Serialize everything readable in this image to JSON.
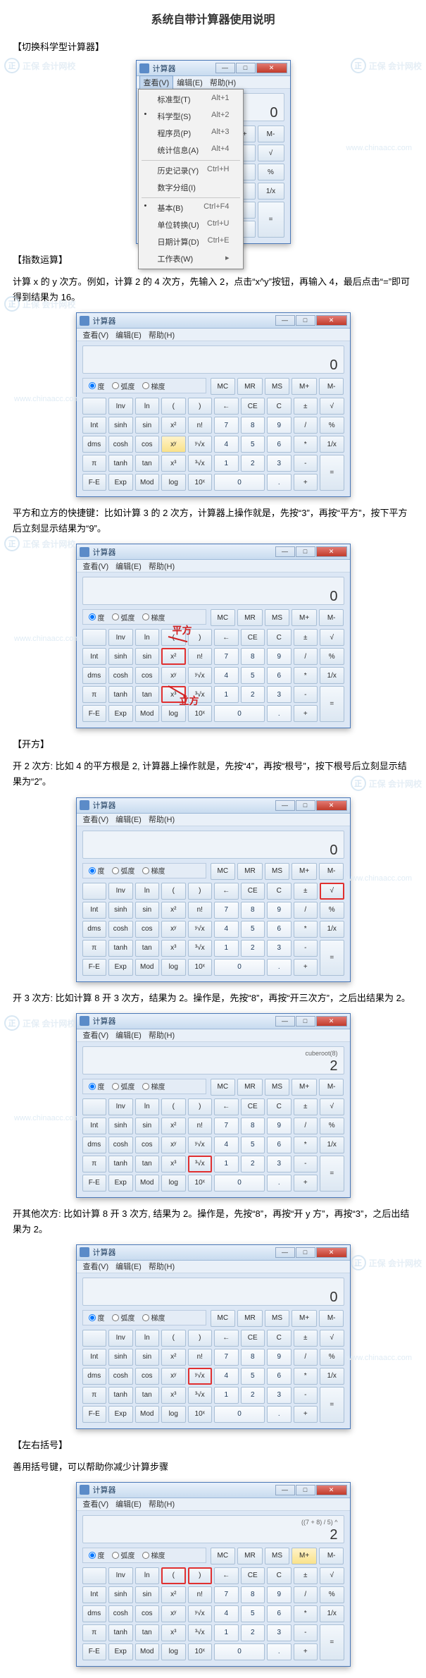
{
  "doc_title": "系统自带计算器使用说明",
  "watermark_brand": "正保 会计网校",
  "watermark_url": "www.chinaacc.com",
  "sections": {
    "s1_heading": "【切换科学型计算器】",
    "s2_heading": "【指数运算】",
    "s2_text": "计算 x 的 y 次方。例如，计算 2 的 4 次方，先输入 2，点击“x^y”按钮，再输入 4，最后点击“=”即可得到结果为 16。",
    "s2b_text": "平方和立方的快捷键：比如计算 3 的 2 次方，计算器上操作就是，先按“3”，再按“平方”，按下平方后立刻显示结果为“9”。",
    "s3_heading": "【开方】",
    "s3_text": "开 2 次方: 比如 4 的平方根是 2, 计算器上操作就是，先按“4”，再按“根号”，按下根号后立刻显示结果为“2”。",
    "s3b_text": "开 3 次方: 比如计算 8 开 3 次方，结果为 2。操作是，先按“8”，再按“开三次方”，之后出结果为 2。",
    "s3c_text": "开其他次方: 比如计算 8 开 3 次方, 结果为 2。操作是，先按“8”，再按“开 y 方”，再按“3”，之后出结果为 2。",
    "s4_heading": "【左右括号】",
    "s4_text": "善用括号键，可以帮助你减少计算步骤"
  },
  "calc": {
    "title": "计算器",
    "minimize": "—",
    "maximize": "□",
    "close": "✕",
    "menu_view": "查看(V)",
    "menu_edit": "编辑(E)",
    "menu_help": "帮助(H)",
    "angle_deg": "度",
    "angle_rad": "弧度",
    "angle_grad": "梯度"
  },
  "dropdown_items": [
    {
      "label": "标准型(T)",
      "shortcut": "Alt+1"
    },
    {
      "label": "科学型(S)",
      "shortcut": "Alt+2",
      "dot": true
    },
    {
      "label": "程序员(P)",
      "shortcut": "Alt+3"
    },
    {
      "label": "统计信息(A)",
      "shortcut": "Alt+4"
    },
    {
      "sep": true
    },
    {
      "label": "历史记录(Y)",
      "shortcut": "Ctrl+H"
    },
    {
      "label": "数字分组(I)",
      "shortcut": ""
    },
    {
      "sep": true
    },
    {
      "label": "基本(B)",
      "shortcut": "Ctrl+F4",
      "dot": true
    },
    {
      "label": "单位转换(U)",
      "shortcut": "Ctrl+U"
    },
    {
      "label": "日期计算(D)",
      "shortcut": "Ctrl+E"
    },
    {
      "label": "工作表(W)",
      "shortcut": "▸"
    }
  ],
  "displays": {
    "d_zero": "0",
    "d_cuberoot_small": "cuberoot(8)",
    "d_cuberoot_main": "2",
    "d_paren_small": "((7 + 8) / 5) ^",
    "d_paren_main": "2"
  },
  "mem_row": [
    "MC",
    "MR",
    "MS",
    "M+",
    "M-"
  ],
  "sci_rows": [
    [
      "",
      "Inv",
      "ln",
      "(",
      ")",
      "←",
      "CE",
      "C",
      "±",
      "√"
    ],
    [
      "Int",
      "sinh",
      "sin",
      "x²",
      "n!",
      "7",
      "8",
      "9",
      "/",
      "%"
    ],
    [
      "dms",
      "cosh",
      "cos",
      "xʸ",
      "ʸ√x",
      "4",
      "5",
      "6",
      "*",
      "1/x"
    ],
    [
      "π",
      "tanh",
      "tan",
      "x³",
      "³√x",
      "1",
      "2",
      "3",
      "-",
      "="
    ],
    [
      "F-E",
      "Exp",
      "Mod",
      "log",
      "10ˣ",
      "0",
      "",
      ".",
      "+",
      ""
    ]
  ],
  "std_rows": [
    [
      "←",
      "CE",
      "C",
      "±",
      "√"
    ],
    [
      "7",
      "8",
      "9",
      "/",
      "%"
    ],
    [
      "4",
      "5",
      "6",
      "*",
      "1/x"
    ],
    [
      "1",
      "2",
      "3",
      "-",
      "="
    ],
    [
      "0",
      "",
      ".",
      "+",
      ""
    ]
  ],
  "anno": {
    "square": "平方",
    "cube": "立方"
  }
}
